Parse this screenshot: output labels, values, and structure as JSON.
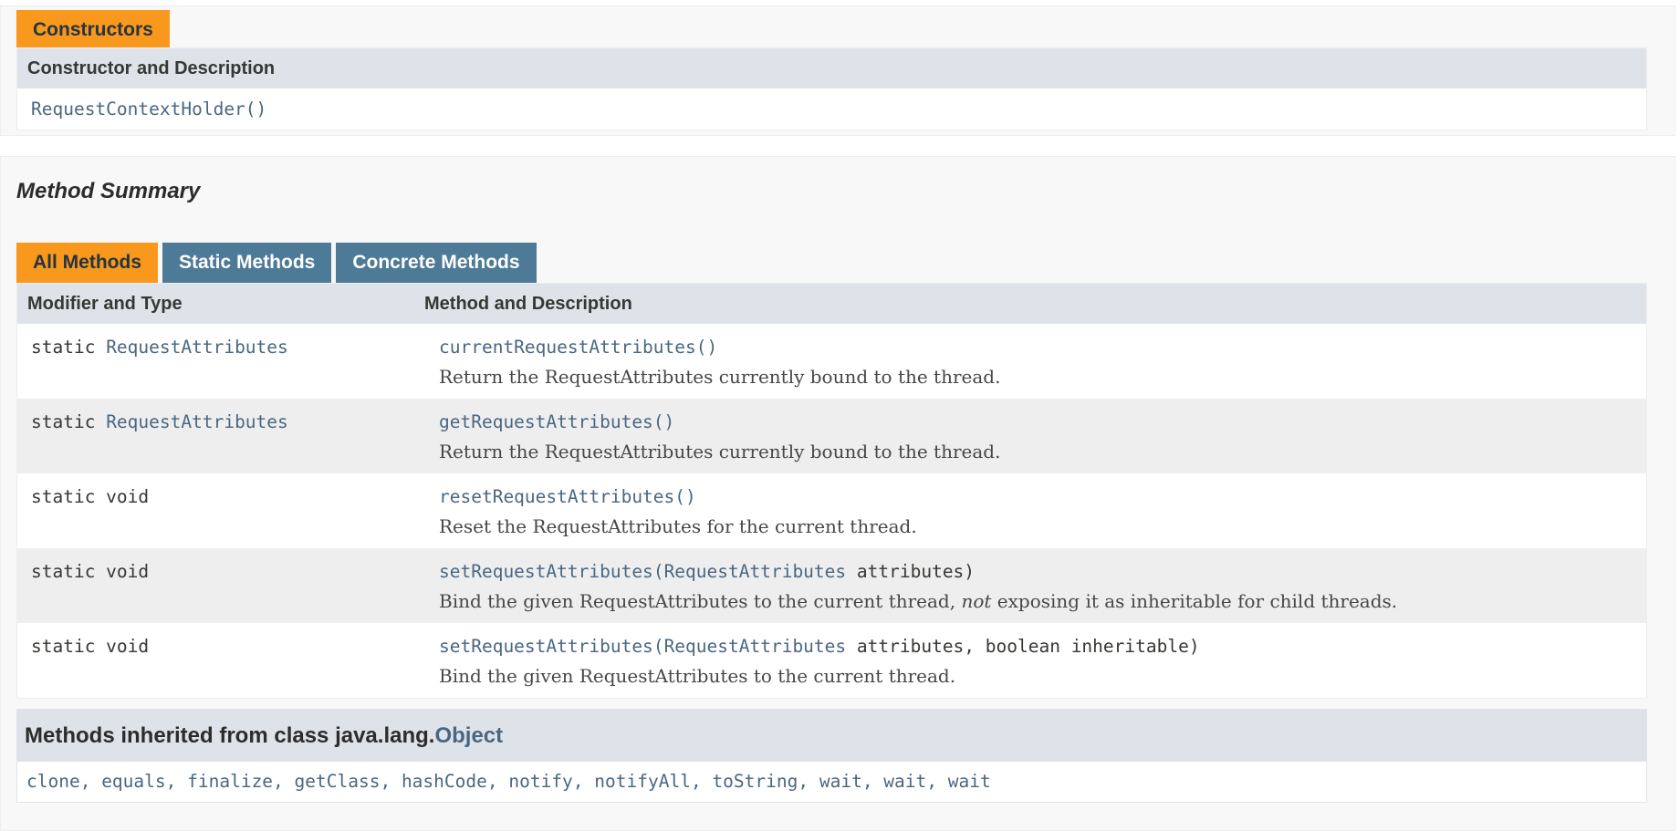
{
  "constructors": {
    "tab_label": "Constructors",
    "header": "Constructor and Description",
    "rows": [
      {
        "signature": "RequestContextHolder()"
      }
    ]
  },
  "method_summary": {
    "title": "Method Summary",
    "tabs": [
      {
        "label": "All Methods",
        "active": true
      },
      {
        "label": "Static Methods",
        "active": false
      },
      {
        "label": "Concrete Methods",
        "active": false
      }
    ],
    "headers": {
      "col1": "Modifier and Type",
      "col2": "Method and Description"
    },
    "rows": [
      {
        "modifier": "static ",
        "type": "RequestAttributes",
        "method": "currentRequestAttributes",
        "params": "()",
        "description": "Return the RequestAttributes currently bound to the thread."
      },
      {
        "modifier": "static ",
        "type": "RequestAttributes",
        "method": "getRequestAttributes",
        "params": "()",
        "description": "Return the RequestAttributes currently bound to the thread."
      },
      {
        "modifier": "static void",
        "type": "",
        "method": "resetRequestAttributes",
        "params": "()",
        "description": "Reset the RequestAttributes for the current thread."
      },
      {
        "modifier": "static void",
        "type": "",
        "method": "setRequestAttributes",
        "params_open": "(",
        "param_type": "RequestAttributes",
        "params_rest": " attributes)",
        "description_pre": "Bind the given RequestAttributes to the current thread, ",
        "description_em": "not",
        "description_post": " exposing it as inheritable for child threads."
      },
      {
        "modifier": "static void",
        "type": "",
        "method": "setRequestAttributes",
        "params_open": "(",
        "param_type": "RequestAttributes",
        "params_rest": " attributes, boolean inheritable)",
        "description": "Bind the given RequestAttributes to the current thread."
      }
    ]
  },
  "inherited": {
    "prefix": "Methods inherited from class java.lang.",
    "class_name": "Object",
    "methods": [
      "clone",
      "equals",
      "finalize",
      "getClass",
      "hashCode",
      "notify",
      "notifyAll",
      "toString",
      "wait",
      "wait",
      "wait"
    ],
    "separator": ", "
  },
  "colors": {
    "tab_active": "#f8981d",
    "tab_inactive": "#4d7a97",
    "header_bg": "#dee3e9",
    "link": "#4a6782"
  }
}
